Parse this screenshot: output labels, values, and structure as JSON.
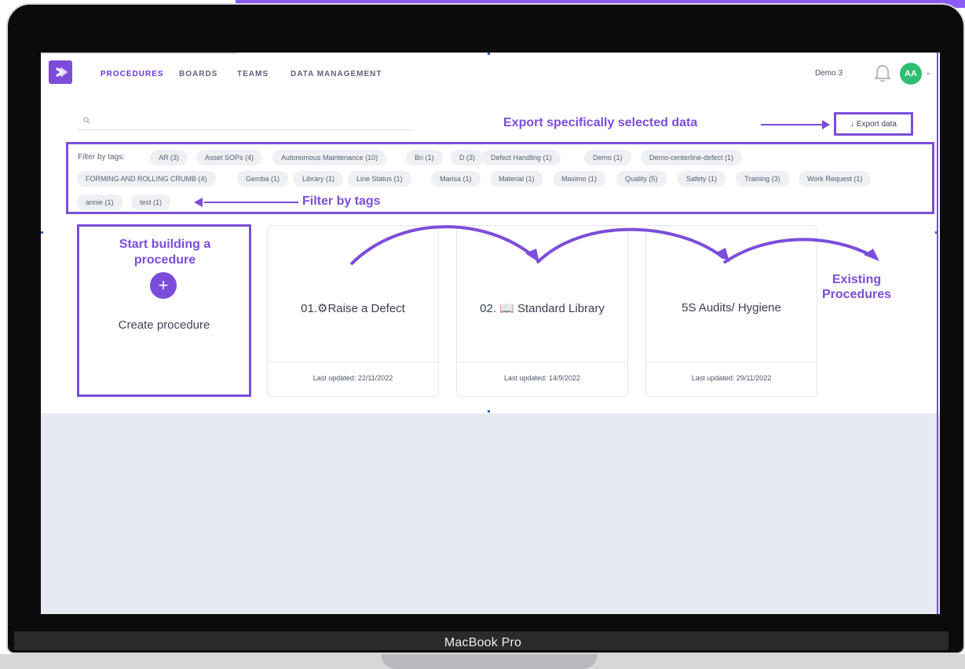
{
  "nav": {
    "items": [
      "PROCEDURES",
      "BOARDS",
      "TEAMS",
      "DATA MANAGEMENT"
    ],
    "workspace": "Demo 3",
    "avatar_initials": "AA",
    "avatar_color": "#2fbf71",
    "bell_icon": "bell-icon",
    "chevron_icon": "chevron-down-icon",
    "logo_icon": "app-logo-icon"
  },
  "search": {
    "placeholder": "",
    "icon": "search-icon"
  },
  "export": {
    "button_label": "↓ Export data",
    "annotation": "Export specifically selected data"
  },
  "filter": {
    "label": "Filter by tags:",
    "annotation": "Filter by tags",
    "tags": [
      "AR (3)",
      "Asset SOPs (4)",
      "Autonomous Maintenance (10)",
      "Bri (1)",
      "D (3)",
      "Defect Handling (1)",
      "Demo (1)",
      "Demo-centerline-defect (1)",
      "FORMING AND ROLLING CRUMB (4)",
      "Gemba (1)",
      "Library (1)",
      "Line Status (1)",
      "Marisa (1)",
      "Material (1)",
      "Maximo (1)",
      "Quality (5)",
      "Safety (1)",
      "Training (3)",
      "Work Request (1)",
      "annie (1)",
      "test (1)"
    ]
  },
  "create": {
    "annotation": "Start building a procedure",
    "plus_label": "+",
    "label": "Create procedure"
  },
  "procedures": [
    {
      "title": "01.⚙Raise a Defect",
      "updated": "Last updated: 22/11/2022"
    },
    {
      "title": "02. 📖 Standard Library",
      "updated": "Last updated: 14/9/2022"
    },
    {
      "title": "5S Audits/ Hygiene",
      "updated": "Last updated: 29/11/2022"
    }
  ],
  "existing_annotation": "Existing Procedures",
  "device": {
    "brand": "MacBook Pro"
  },
  "colors": {
    "accent": "#7c4ddb",
    "background": "#e7eaf2",
    "tag_bg": "#eef0f4"
  }
}
